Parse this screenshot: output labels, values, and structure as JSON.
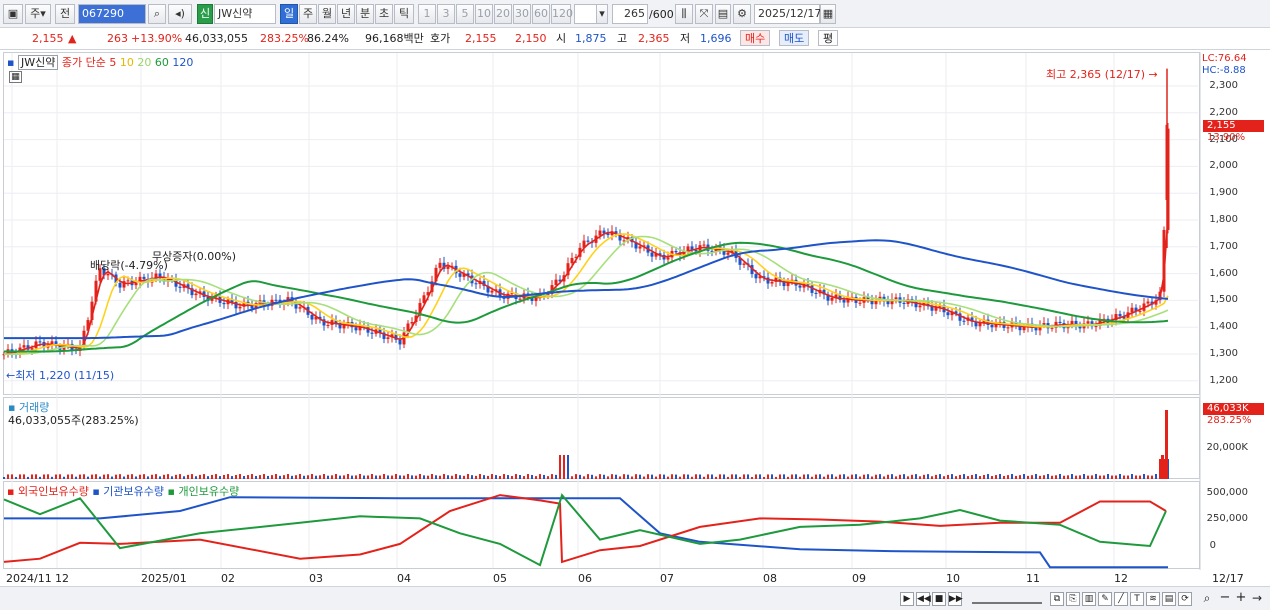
{
  "toolbar": {
    "type_label": "주",
    "jeon_label": "전",
    "code": "067290",
    "name_badge": "신",
    "name": "JW신약",
    "periods": [
      "일",
      "주",
      "월",
      "년",
      "분",
      "초",
      "틱"
    ],
    "intervals": [
      "1",
      "3",
      "5",
      "10",
      "20",
      "30",
      "60",
      "120"
    ],
    "count": "265",
    "count_max": "/600",
    "date": "2025/12/17"
  },
  "quote": {
    "price": "2,155",
    "change": "263",
    "change_pct": "+13.90%",
    "volume": "46,033,055",
    "volume_ratio": "283.25%",
    "turnover": "86.24%",
    "amount": "96,168백만",
    "hoga_label": "호가",
    "ask": "2,155",
    "bid": "2,150",
    "open_label": "시",
    "open": "1,875",
    "high_label": "고",
    "high": "2,365",
    "low_label": "저",
    "low": "1,696",
    "buy_label": "매수",
    "sell_label": "매도",
    "eval_label": "평"
  },
  "price_panel": {
    "stock_label": "JW신약",
    "ma_label": "종가 단순",
    "ma_periods": [
      "5",
      "10",
      "20",
      "60",
      "120"
    ],
    "ma_colors": [
      "#e3231b",
      "#ffd21a",
      "#a6e07a",
      "#1e9a3c",
      "#1f54c9"
    ],
    "lc": "LC:76.64",
    "hc": "HC:-8.88",
    "high_marker": "최고 2,365 (12/17)",
    "low_marker": "최저 1,220 (11/15)",
    "event1": "배당락(-4.79%)",
    "event2": "무상증자(0.00%)",
    "y_ticks": [
      "2,300",
      "2,200",
      "2,100",
      "2,000",
      "1,900",
      "1,800",
      "1,700",
      "1,600",
      "1,500",
      "1,400",
      "1,300",
      "1,200"
    ],
    "last_price_tag": "2,155",
    "last_pct_tag": "13.90%"
  },
  "volume_panel": {
    "title": "거래량",
    "value_text": "46,033,055주(283.25%)",
    "tag": "46,033K",
    "tag_pct": "283.25%",
    "y_tick": "20,000K"
  },
  "holding_panel": {
    "series_labels": [
      "외국인보유수량",
      "기관보유수량",
      "개인보유수량"
    ],
    "series_colors": [
      "#e3231b",
      "#1f54c9",
      "#1e9a3c"
    ],
    "y_ticks": [
      "500,000",
      "250,000",
      "0"
    ]
  },
  "x_axis": {
    "labels": [
      "2024/11",
      "12",
      "2025/01",
      "02",
      "03",
      "04",
      "05",
      "06",
      "07",
      "08",
      "09",
      "10",
      "11",
      "12"
    ],
    "right_label": "12/17"
  }
}
